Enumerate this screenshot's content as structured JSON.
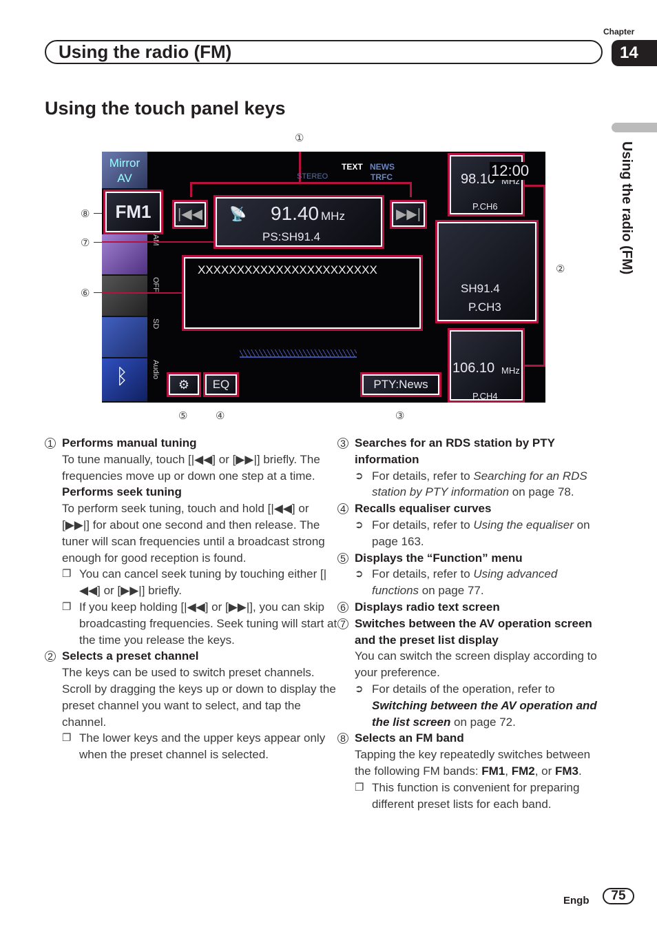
{
  "header": {
    "title": "Using the radio (FM)",
    "chapter_label": "Chapter",
    "chapter_number": "14",
    "side_tab": "Using the radio (FM)"
  },
  "section_title": "Using the touch panel keys",
  "screen": {
    "mirror_av": "Mirror AV",
    "band": "FM1",
    "frequency": "91.40",
    "unit": "MHz",
    "ps": "PS:SH91.4",
    "stereo": "STEREO",
    "text": "TEXT",
    "news": "NEWS",
    "trfc": "TRFC",
    "radio_text": "XXXXXXXXXXXXXXXXXXXXXXX",
    "clock": "12:00",
    "presets": [
      {
        "freq": "98.10",
        "unit": "MHz",
        "ch": "P.CH6"
      },
      {
        "name": "SH91.4",
        "ch": "P.CH3"
      },
      {
        "freq": "106.10",
        "unit": "MHz",
        "ch": "P.CH4"
      }
    ],
    "side_labels": [
      "AM",
      "OFF",
      "SD",
      "Audio"
    ],
    "eq": "EQ",
    "pty": "PTY:News",
    "accent": "#b5123f"
  },
  "callouts": [
    "①",
    "②",
    "③",
    "④",
    "⑤",
    "⑥",
    "⑦",
    "⑧"
  ],
  "left": {
    "i1": {
      "num": "1",
      "title": "Performs manual tuning",
      "body": "To tune manually, touch [|◀◀] or [▶▶|] briefly. The frequencies move up or down one step at a time.",
      "title2": "Performs seek tuning",
      "body2": "To perform seek tuning, touch and hold [|◀◀] or [▶▶|] for about one second and then release. The tuner will scan frequencies until a broadcast strong enough for good reception is found.",
      "b1": "You can cancel seek tuning by touching either [|◀◀] or [▶▶|] briefly.",
      "b2": "If you keep holding [|◀◀] or [▶▶|], you can skip broadcasting frequencies. Seek tuning will start at the time you release the keys."
    },
    "i2": {
      "num": "2",
      "title": "Selects a preset channel",
      "body": "The keys can be used to switch preset channels.",
      "body2": "Scroll by dragging the keys up or down to display the preset channel you want to select, and tap the channel.",
      "b1": "The lower keys and the upper keys appear only when the preset channel is selected."
    }
  },
  "right": {
    "i3": {
      "num": "3",
      "title": "Searches for an RDS station by PTY information",
      "pre": "For details, refer to ",
      "ref": "Searching for an RDS station by PTY information",
      "post": " on page 78."
    },
    "i4": {
      "num": "4",
      "title": "Recalls equaliser curves",
      "pre": "For details, refer to ",
      "ref": "Using the equaliser",
      "post": " on page 163."
    },
    "i5": {
      "num": "5",
      "title": "Displays the “Function” menu",
      "pre": "For details, refer to ",
      "ref": "Using advanced functions",
      "post": " on page 77."
    },
    "i6": {
      "num": "6",
      "title": "Displays radio text screen"
    },
    "i7": {
      "num": "7",
      "title": "Switches between the AV operation screen and the preset list display",
      "body": "You can switch the screen display according to your preference.",
      "pre": "For details of the operation, refer to ",
      "ref": "Switching between the AV operation and the list screen",
      "post": " on page 72."
    },
    "i8": {
      "num": "8",
      "title": "Selects an FM band",
      "body": "Tapping the key repeatedly switches between the following FM bands: ",
      "fm1": "FM1",
      "fm2": "FM2",
      "fm3": "FM3",
      "sep1": ", ",
      "sep2": ", or ",
      "end": ".",
      "b1": "This function is convenient for preparing different preset lists for each band."
    }
  },
  "footer": {
    "lang": "Engb",
    "page": "75"
  }
}
